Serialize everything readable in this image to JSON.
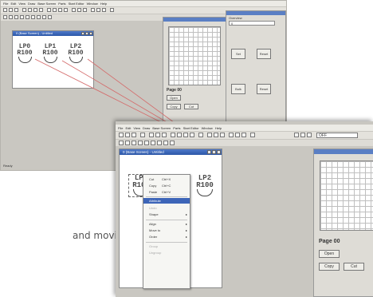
{
  "menu": [
    "File",
    "Edit",
    "View",
    "Draw",
    "Base Screen",
    "Parts",
    "Start Editor",
    "Window",
    "Help"
  ],
  "toolbar_combo": "OFF",
  "screen_window_title": "0 (Base Screen) - Untitled",
  "lamps": [
    {
      "top": "LP0",
      "bottom": "R100"
    },
    {
      "top": "LP1",
      "bottom": "R100"
    },
    {
      "top": "LP2",
      "bottom": "R100"
    }
  ],
  "side_panel": {
    "title": "Overview",
    "combo": "0",
    "buttons": [
      "Set",
      "Reset",
      "Bulk"
    ],
    "page_label": "Page 00",
    "open_btn": "Open",
    "copy_btn": "Copy",
    "cut_btn": "Cut"
  },
  "context_menu": [
    {
      "label": "Cut",
      "shortcut": "Ctrl+X"
    },
    {
      "label": "Copy",
      "shortcut": "Ctrl+C"
    },
    {
      "label": "Paste",
      "shortcut": "Ctrl+V"
    },
    {
      "label": "Attribute",
      "shortcut": ""
    },
    {
      "label": "Undo",
      "shortcut": ""
    },
    {
      "label": "Shape",
      "shortcut": ""
    },
    {
      "label": "Align",
      "shortcut": ""
    },
    {
      "label": "Move to",
      "shortcut": ""
    },
    {
      "label": "Order",
      "shortcut": ""
    },
    {
      "label": "Group",
      "shortcut": ""
    },
    {
      "label": "Ungroup",
      "shortcut": ""
    }
  ],
  "status": "Ready",
  "caption": "and moving",
  "colors": {
    "title_bar": "#2c57a8",
    "menu_highlight": "#3d65b8",
    "guide_lines": "#d46a6a"
  }
}
